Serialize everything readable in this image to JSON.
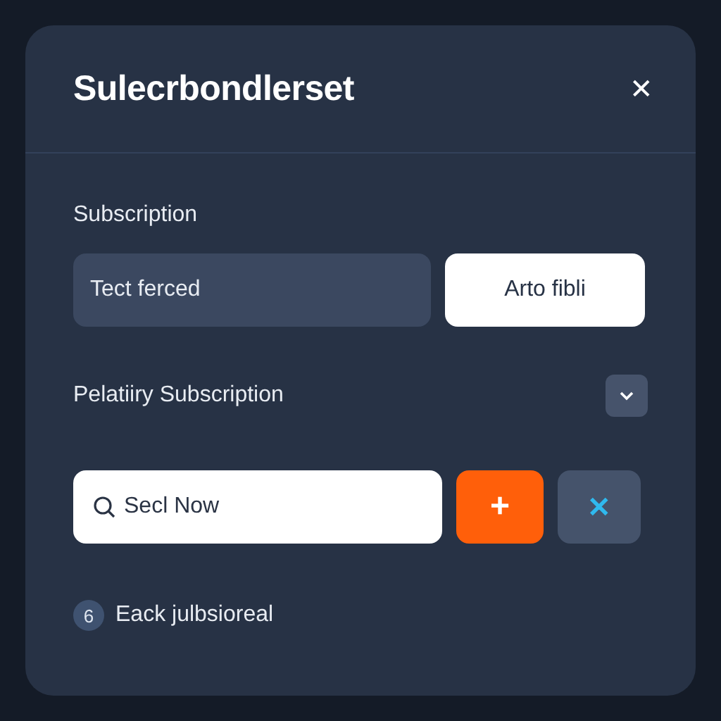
{
  "dialog": {
    "title": "Sulecrbondlerset",
    "close_label": "✕"
  },
  "section_label": "Subscription",
  "text_field": {
    "value": "Tect ferced"
  },
  "auto_fill_button": {
    "label": "Arto fibli"
  },
  "dropdown_row": {
    "label": "Pelatiiry Subscription",
    "expanded": false
  },
  "search": {
    "value": "Secl Now"
  },
  "add_button": {
    "label": "+"
  },
  "clear_button": {
    "label": "✕"
  },
  "footer": {
    "badge": "6",
    "text": "Eack julbsioreal"
  }
}
